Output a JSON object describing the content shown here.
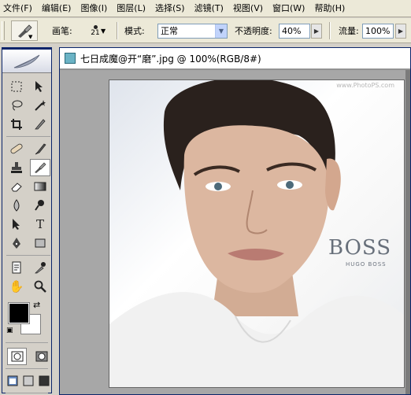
{
  "menubar": {
    "items": [
      "文件(F)",
      "编辑(E)",
      "图像(I)",
      "图层(L)",
      "选择(S)",
      "滤镜(T)",
      "视图(V)",
      "窗口(W)",
      "帮助(H)"
    ]
  },
  "options": {
    "brush_label": "画笔:",
    "brush_size": "21",
    "mode_label": "模式:",
    "mode_value": "正常",
    "opacity_label": "不透明度:",
    "opacity_value": "40%",
    "flow_label": "流量:",
    "flow_value": "100%"
  },
  "document": {
    "title": "七日成魔@开“磨”.jpg @ 100%(RGB/8#)"
  },
  "photo": {
    "watermark": "www.PhotoPS.com",
    "brand": "BOSS",
    "brand_sub": "HUGO BOSS"
  },
  "toolbox": {
    "active_tool": "healing-brush",
    "foreground_color": "#000000",
    "background_color": "#ffffff"
  }
}
